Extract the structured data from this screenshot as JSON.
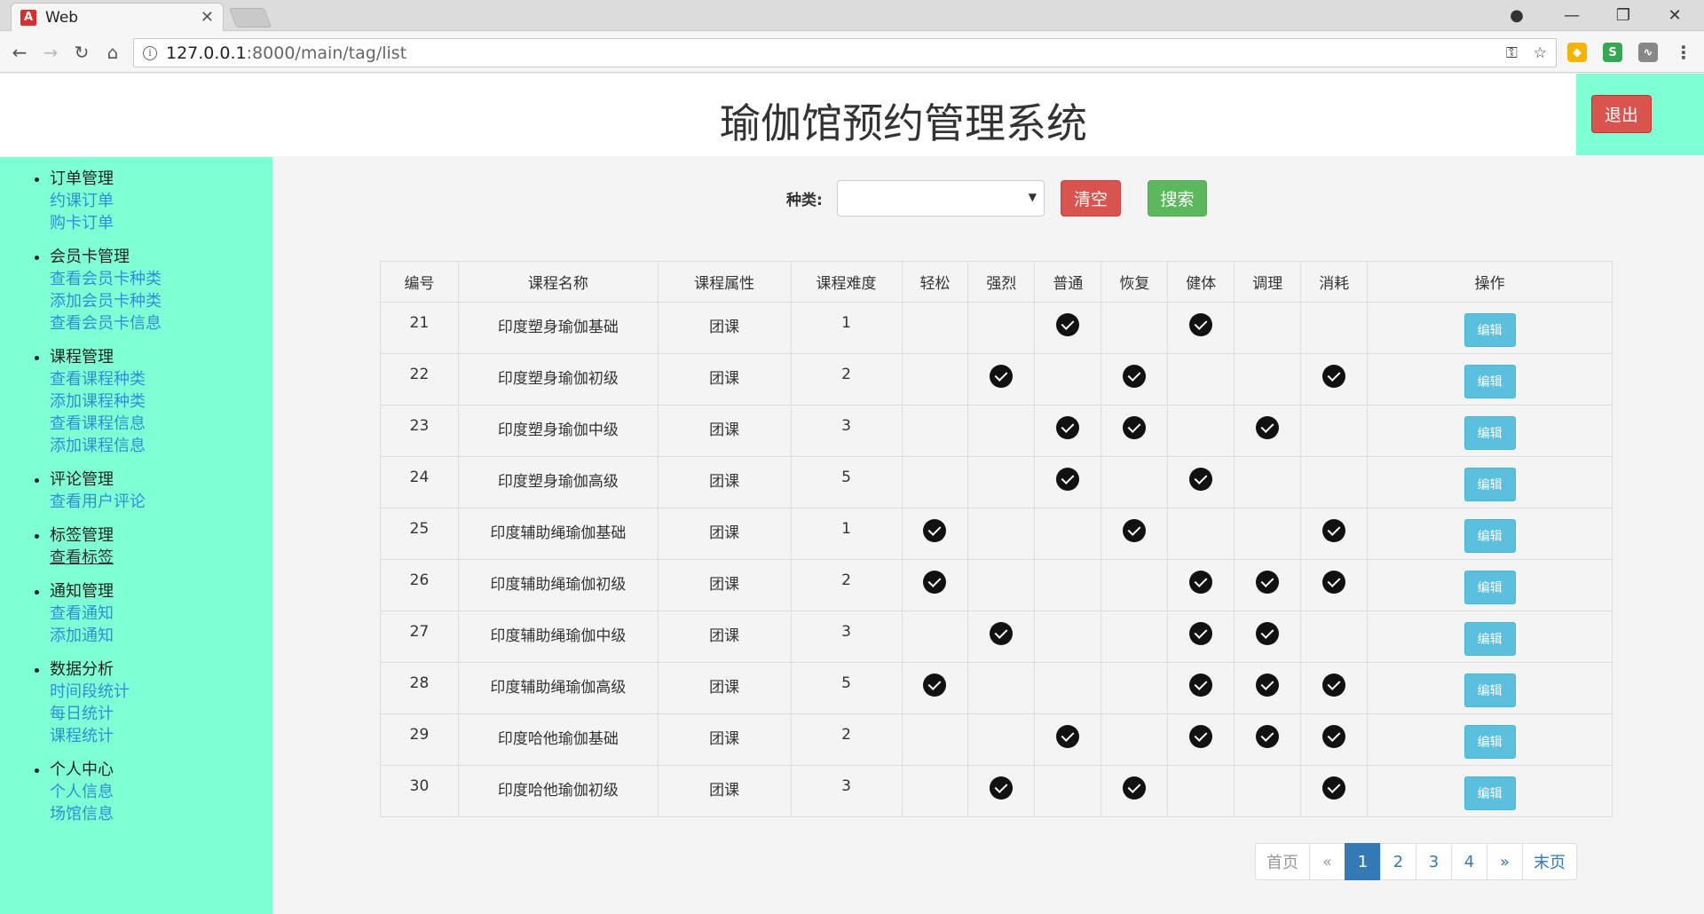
{
  "browser": {
    "tab_title": "Web",
    "tab_icon": "A",
    "url_host": "127.0.0.1",
    "url_path": ":8000/main/tag/list"
  },
  "header": {
    "title": "瑜伽馆预约管理系统",
    "logout_label": "退出"
  },
  "sidebar": {
    "groups": [
      {
        "title": "订单管理",
        "items": [
          "约课订单",
          "购卡订单"
        ]
      },
      {
        "title": "会员卡管理",
        "items": [
          "查看会员卡种类",
          "添加会员卡种类",
          "查看会员卡信息"
        ]
      },
      {
        "title": "课程管理",
        "items": [
          "查看课程种类",
          "添加课程种类",
          "查看课程信息",
          "添加课程信息"
        ]
      },
      {
        "title": "评论管理",
        "items": [
          "查看用户评论"
        ]
      },
      {
        "title": "标签管理",
        "items": [
          "查看标签"
        ]
      },
      {
        "title": "通知管理",
        "items": [
          "查看通知",
          "添加通知"
        ]
      },
      {
        "title": "数据分析",
        "items": [
          "时间段统计",
          "每日统计",
          "课程统计"
        ]
      },
      {
        "title": "个人中心",
        "items": [
          "个人信息",
          "场馆信息"
        ]
      }
    ],
    "active_item": "查看标签"
  },
  "search": {
    "label": "种类:",
    "select_value": "",
    "clear_label": "清空",
    "search_label": "搜索"
  },
  "table": {
    "columns": [
      "编号",
      "课程名称",
      "课程属性",
      "课程难度",
      "轻松",
      "强烈",
      "普通",
      "恢复",
      "健体",
      "调理",
      "消耗",
      "操作"
    ],
    "edit_label": "编辑",
    "rows": [
      {
        "id": "21",
        "name": "印度塑身瑜伽基础",
        "attr": "团课",
        "level": "1",
        "tags": [
          false,
          false,
          true,
          false,
          true,
          false,
          false
        ]
      },
      {
        "id": "22",
        "name": "印度塑身瑜伽初级",
        "attr": "团课",
        "level": "2",
        "tags": [
          false,
          true,
          false,
          true,
          false,
          false,
          true
        ]
      },
      {
        "id": "23",
        "name": "印度塑身瑜伽中级",
        "attr": "团课",
        "level": "3",
        "tags": [
          false,
          false,
          true,
          true,
          false,
          true,
          false
        ]
      },
      {
        "id": "24",
        "name": "印度塑身瑜伽高级",
        "attr": "团课",
        "level": "5",
        "tags": [
          false,
          false,
          true,
          false,
          true,
          false,
          false
        ]
      },
      {
        "id": "25",
        "name": "印度辅助绳瑜伽基础",
        "attr": "团课",
        "level": "1",
        "tags": [
          true,
          false,
          false,
          true,
          false,
          false,
          true
        ]
      },
      {
        "id": "26",
        "name": "印度辅助绳瑜伽初级",
        "attr": "团课",
        "level": "2",
        "tags": [
          true,
          false,
          false,
          false,
          true,
          true,
          true
        ]
      },
      {
        "id": "27",
        "name": "印度辅助绳瑜伽中级",
        "attr": "团课",
        "level": "3",
        "tags": [
          false,
          true,
          false,
          false,
          true,
          true,
          false
        ]
      },
      {
        "id": "28",
        "name": "印度辅助绳瑜伽高级",
        "attr": "团课",
        "level": "5",
        "tags": [
          true,
          false,
          false,
          false,
          true,
          true,
          true
        ]
      },
      {
        "id": "29",
        "name": "印度哈他瑜伽基础",
        "attr": "团课",
        "level": "2",
        "tags": [
          false,
          false,
          true,
          false,
          true,
          true,
          true
        ]
      },
      {
        "id": "30",
        "name": "印度哈他瑜伽初级",
        "attr": "团课",
        "level": "3",
        "tags": [
          false,
          true,
          false,
          true,
          false,
          false,
          true
        ]
      }
    ]
  },
  "pagination": {
    "first": "首页",
    "prev": "«",
    "pages": [
      "1",
      "2",
      "3",
      "4"
    ],
    "current": "1",
    "next": "»",
    "last": "末页"
  },
  "colors": {
    "sidebar_bg": "#7fffd4",
    "link": "#2f8fd6",
    "danger": "#d9534f",
    "success": "#5cb85c",
    "info": "#5bc0de",
    "primary": "#337ab7"
  }
}
